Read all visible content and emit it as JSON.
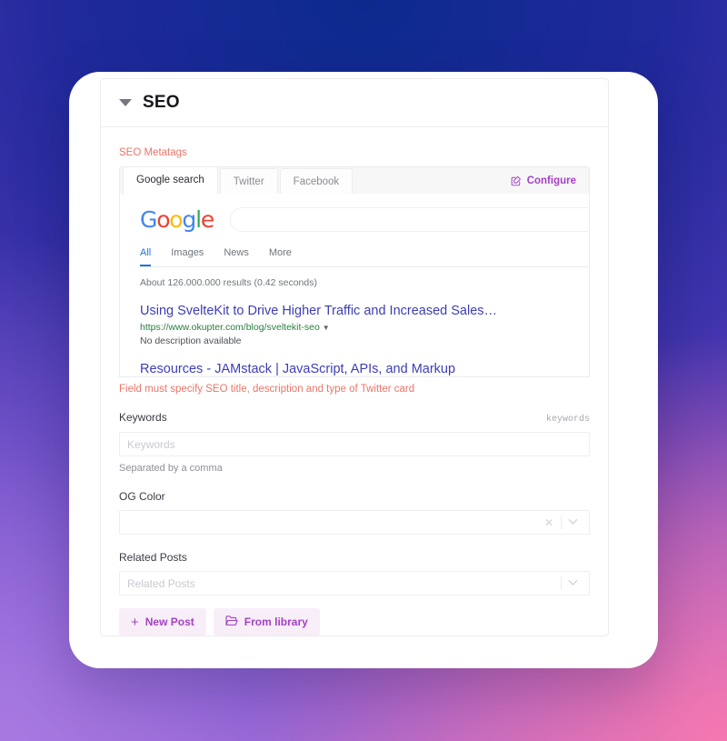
{
  "background": {
    "top_left": "#0a2a8c",
    "top_right": "#3a34ab",
    "bottom_left": "#a77ae2",
    "bottom_right": "#f478b0"
  },
  "panel": {
    "title": "SEO",
    "collapse_icon": "caret-down-icon"
  },
  "seo": {
    "metatags_label": "SEO Metatags",
    "tabs": [
      {
        "label": "Google search",
        "active": true
      },
      {
        "label": "Twitter",
        "active": false
      },
      {
        "label": "Facebook",
        "active": false
      }
    ],
    "configure": {
      "label": "Configure",
      "icon": "edit-square-icon",
      "color": "#a342c4"
    },
    "error": "Field must specify SEO title, description and type of Twitter card"
  },
  "google_preview": {
    "logo": {
      "letters": [
        "G",
        "o",
        "o",
        "g",
        "l",
        "e"
      ]
    },
    "search_value": "",
    "nav": [
      {
        "label": "All",
        "selected": true
      },
      {
        "label": "Images",
        "selected": false
      },
      {
        "label": "News",
        "selected": false
      },
      {
        "label": "More",
        "selected": false
      }
    ],
    "stats": "About 126.000.000 results (0.42 seconds)",
    "results": [
      {
        "title": "Using SvelteKit to Drive Higher Traffic and Increased Sales…",
        "url": "https://www.okupter.com/blog/sveltekit-seo",
        "description": "No description available"
      },
      {
        "title": "Resources - JAMstack | JavaScript, APIs, and Markup"
      }
    ]
  },
  "fields": {
    "keywords": {
      "label": "Keywords",
      "hint_right": "keywords",
      "placeholder": "Keywords",
      "value": "",
      "sub": "Separated by a comma"
    },
    "og_color": {
      "label": "OG Color",
      "value": "",
      "clear_icon": "close-icon",
      "dropdown_icon": "chevron-down-icon"
    },
    "related_posts": {
      "label": "Related Posts",
      "placeholder": "Related Posts",
      "value": "",
      "dropdown_icon": "chevron-down-icon"
    }
  },
  "buttons": {
    "new_post": {
      "label": "New Post",
      "icon": "plus-icon"
    },
    "from_library": {
      "label": "From library",
      "icon": "folder-open-icon"
    }
  }
}
